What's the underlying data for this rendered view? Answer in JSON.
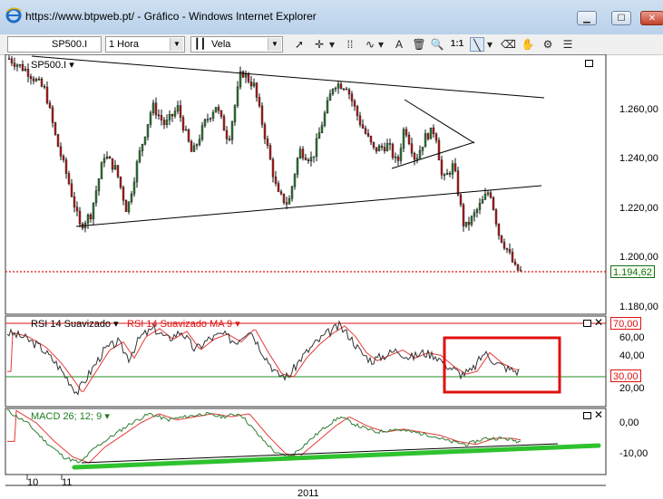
{
  "window": {
    "title": "https://www.btpweb.pt/ - Gráfico - Windows Internet Explorer",
    "minimize_label": "▁",
    "maximize_label": "☐",
    "close_label": "✕"
  },
  "toolbar": {
    "symbol": "SP500.I",
    "interval": "1 Hora",
    "chart_type": "Vela",
    "zoom_label": "1:1",
    "icons": [
      "cursor-icon",
      "crosshair-icon",
      "grid-icon",
      "wave-icon",
      "text-icon",
      "trash-icon",
      "zoom-icon",
      "zoom-reset-icon",
      "trendline-icon",
      "eraser-icon",
      "hand-icon",
      "settings-icon"
    ]
  },
  "chart": {
    "price_pane": {
      "title": "SP500.I",
      "ticks": [
        "1.260,00",
        "1.240,00",
        "1.220,00",
        "1.200,00",
        "1.180,00"
      ],
      "tick_values": [
        1260,
        1240,
        1220,
        1200,
        1180
      ],
      "last_price": "1.194,62",
      "last_value": 1194.62
    },
    "rsi_pane": {
      "label_rsi": "RSI 14 Suavizado",
      "label_ma": "RSI 14 Suavizado MA 9",
      "ticks": [
        "60,00",
        "40,00",
        "20,00"
      ],
      "tick_values": [
        60,
        40,
        20
      ],
      "upper_level": "70,00",
      "lower_level": "30,00",
      "upper_value": 70,
      "lower_value": 30
    },
    "macd_pane": {
      "label": "MACD 26; 12; 9",
      "ticks": [
        "0,00",
        "-10,00"
      ],
      "tick_values": [
        0,
        -10
      ]
    },
    "x_axis": {
      "labels": [
        "10",
        "11"
      ],
      "year": "2011"
    },
    "colors": {
      "bull": "#2e7d32",
      "bear": "#b71c1c",
      "rsi": "#333333",
      "ma": "#e53935",
      "highlight": "#e01010",
      "green_line": "#2ec22e",
      "level": "#e01010",
      "lower_level": "#1f8f1f"
    }
  }
}
